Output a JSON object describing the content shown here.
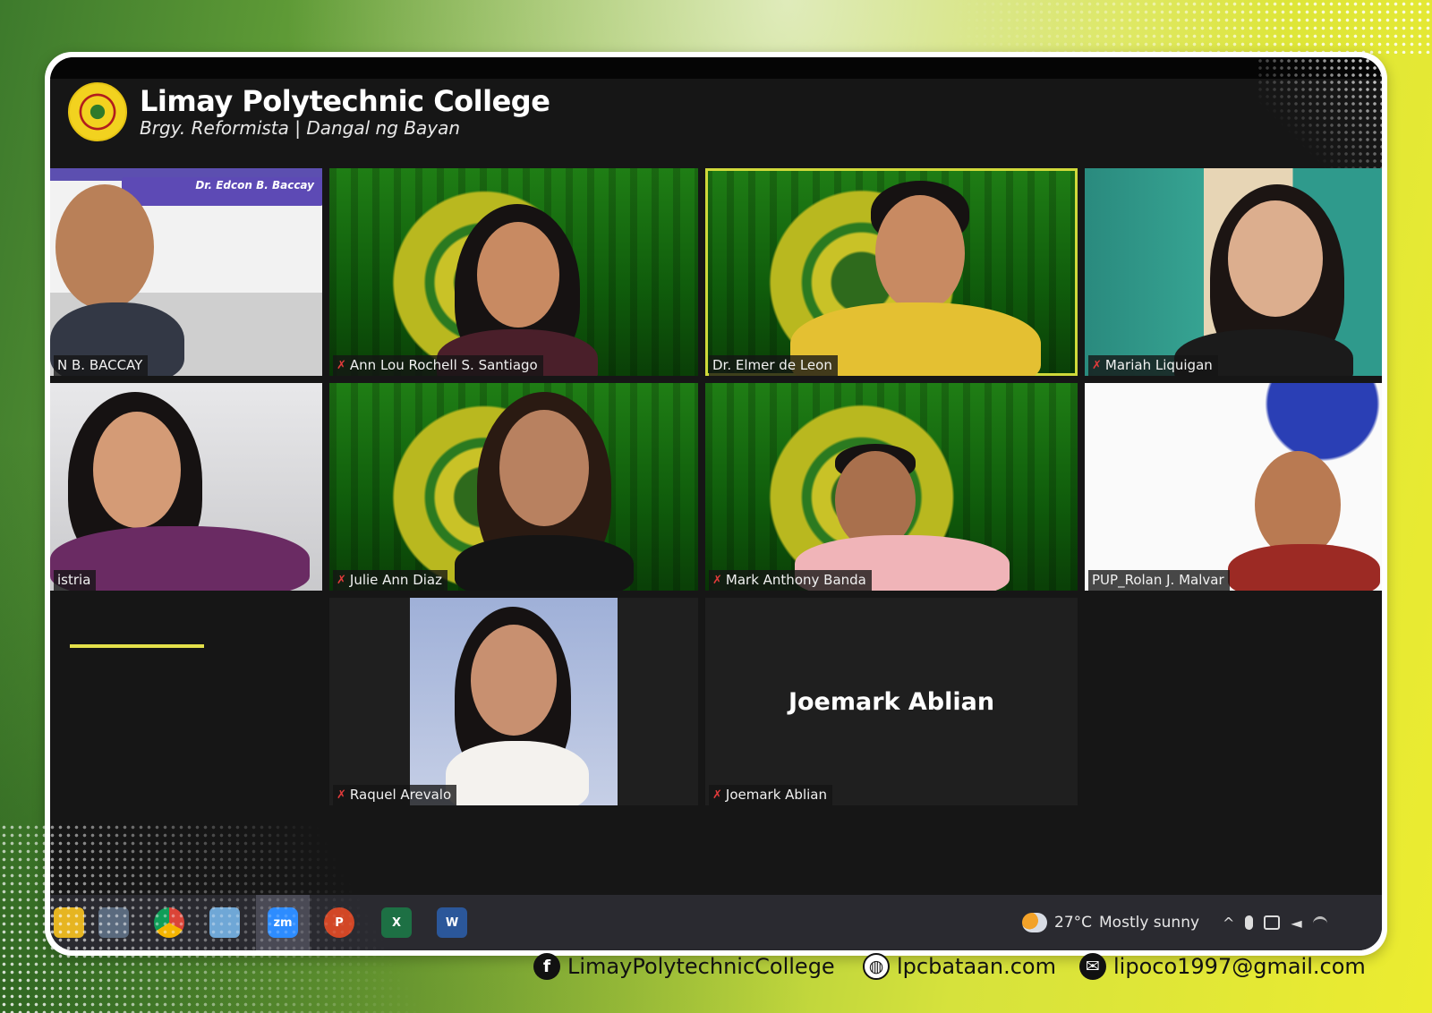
{
  "brand": {
    "title": "Limay Polytechnic College",
    "subtitle": "Brgy. Reformista | Dangal ng Bayan"
  },
  "participants": [
    {
      "id": "baccay",
      "label": "N B. BACCAY",
      "banner": "Dr. Edcon B. Baccay",
      "muted": false
    },
    {
      "id": "santiago",
      "label": "Ann Lou Rochell S. Santiago",
      "muted": true
    },
    {
      "id": "deleon",
      "label": "Dr. Elmer de Leon",
      "muted": false,
      "active_speaker": true
    },
    {
      "id": "liquigan",
      "label": "Mariah Liquigan",
      "muted": true
    },
    {
      "id": "astria",
      "label": "istria",
      "muted": false
    },
    {
      "id": "diaz",
      "label": "Julie Ann Diaz",
      "muted": true
    },
    {
      "id": "banda",
      "label": "Mark Anthony Banda",
      "muted": true
    },
    {
      "id": "malvar",
      "label": "PUP_Rolan J. Malvar",
      "muted": false
    },
    {
      "id": "arevalo",
      "label": "Raquel Arevalo",
      "muted": true
    },
    {
      "id": "ablian",
      "label": "Joemark Ablian",
      "center_name": "Joemark Ablian",
      "muted": true
    }
  ],
  "taskbar": {
    "apps": [
      "file-explorer-icon",
      "calculator-icon",
      "chrome-icon",
      "notepad-icon",
      "zoom-icon",
      "powerpoint-icon",
      "excel-icon",
      "word-icon"
    ],
    "zoom_label": "zm",
    "powerpoint_label": "P",
    "excel_label": "X",
    "word_label": "W",
    "temperature": "27°C",
    "weather": "Mostly sunny"
  },
  "footer": {
    "facebook": "LimayPolytechnicCollege",
    "website": "lpcbataan.com",
    "email": "lipoco1997@gmail.com"
  },
  "colors": {
    "active_speaker_border": "#cfd93a",
    "screen_bg": "#161616",
    "mute_icon": "#e23b3b"
  }
}
